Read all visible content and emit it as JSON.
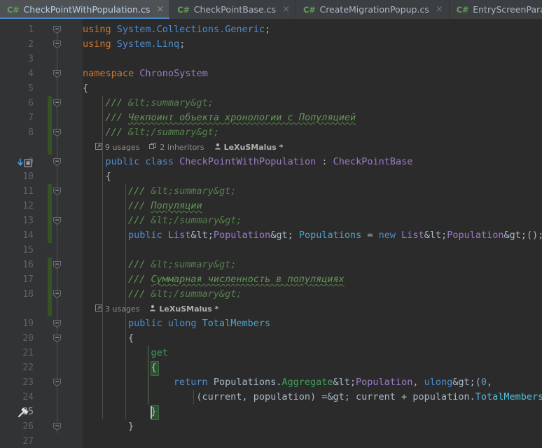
{
  "window": {
    "app": "IDE code editor",
    "theme_bg": "#2b2b2b",
    "gutter_bg": "#313335",
    "tabbar_bg": "#3c3f41",
    "accent": "#4a88c7",
    "changebar_color": "#375224"
  },
  "tabs": [
    {
      "icon": "csharp-file-icon",
      "icon_label": "C#",
      "label": "CheckPointWithPopulation.cs",
      "close": "×",
      "active": true
    },
    {
      "icon": "csharp-file-icon",
      "icon_label": "C#",
      "label": "CheckPointBase.cs",
      "close": "×",
      "active": false
    },
    {
      "icon": "csharp-file-icon",
      "icon_label": "C#",
      "label": "CreateMigrationPopup.cs",
      "close": "×",
      "active": false
    },
    {
      "icon": "csharp-file-icon",
      "icon_label": "C#",
      "label": "EntryScreenParamsBlockLoops.cs",
      "close": "×",
      "active": false
    }
  ],
  "editor": {
    "language": "csharp",
    "current_line": 25,
    "line_numbers": [
      1,
      2,
      3,
      4,
      5,
      6,
      7,
      8,
      9,
      10,
      11,
      12,
      13,
      14,
      15,
      16,
      17,
      18,
      19,
      20,
      21,
      22,
      23,
      24,
      25,
      26,
      27
    ],
    "lines": [
      {
        "n": 1,
        "text": "using System.Collections.Generic;"
      },
      {
        "n": 2,
        "text": "using System.Linq;"
      },
      {
        "n": 3,
        "text": ""
      },
      {
        "n": 4,
        "text": "namespace ChronoSystem"
      },
      {
        "n": 5,
        "text": "{"
      },
      {
        "n": 6,
        "text": "    /// <summary>"
      },
      {
        "n": 7,
        "text": "    /// Чекпоинт объекта хронологии с Популяцией"
      },
      {
        "n": 8,
        "text": "    /// </summary>"
      },
      {
        "n": 9,
        "text": "    public class CheckPointWithPopulation : CheckPointBase"
      },
      {
        "n": 10,
        "text": "    {"
      },
      {
        "n": 11,
        "text": "        /// <summary>"
      },
      {
        "n": 12,
        "text": "        /// Популяции"
      },
      {
        "n": 13,
        "text": "        /// </summary>"
      },
      {
        "n": 14,
        "text": "        public List<Population> Populations = new List<Population>();"
      },
      {
        "n": 15,
        "text": ""
      },
      {
        "n": 16,
        "text": "        /// <summary>"
      },
      {
        "n": 17,
        "text": "        /// Суммарная численность в популяциях"
      },
      {
        "n": 18,
        "text": "        /// </summary>"
      },
      {
        "n": 19,
        "text": "        public ulong TotalMembers"
      },
      {
        "n": 20,
        "text": "        {"
      },
      {
        "n": 21,
        "text": "            get"
      },
      {
        "n": 22,
        "text": "            {"
      },
      {
        "n": 23,
        "text": "                return Populations.Aggregate<Population, ulong>(0,"
      },
      {
        "n": 24,
        "text": "                    (current, population) => current + population.TotalMembers);"
      },
      {
        "n": 25,
        "text": "            }"
      },
      {
        "n": 26,
        "text": "        }"
      },
      {
        "n": 27,
        "text": ""
      }
    ],
    "code_tokens": {
      "l1": {
        "kw": "using",
        "ns": "System.Collections.Generic",
        "semi": ";"
      },
      "l2": {
        "kw": "using",
        "ns": "System.Linq",
        "semi": ";"
      },
      "l4": {
        "kw": "namespace",
        "name": "ChronoSystem"
      },
      "l5": {
        "brace": "{"
      },
      "l6": {
        "comment": "/// ",
        "tag": "<summary>"
      },
      "l7": {
        "comment": "/// ",
        "text": "Чекпоинт объекта хронологии с Популяцией"
      },
      "l8": {
        "comment": "/// ",
        "tag": "</summary>"
      },
      "l9": {
        "mod": "public",
        "kw": "class",
        "name": "CheckPointWithPopulation",
        "colon": " : ",
        "base": "CheckPointBase"
      },
      "l10": {
        "brace": "{"
      },
      "l11": {
        "comment": "/// ",
        "tag": "<summary>"
      },
      "l12": {
        "comment": "/// ",
        "text": "Популяции"
      },
      "l13": {
        "comment": "/// ",
        "tag": "</summary>"
      },
      "l14": {
        "mod": "public",
        "type": "List",
        "lt": "<",
        "generic": "Population",
        "gt": ">",
        "field": "Populations",
        "eq": " = ",
        "new": "new",
        "type2": "List",
        "generic2": "Population",
        "tail": "();"
      },
      "l16": {
        "comment": "/// ",
        "tag": "<summary>"
      },
      "l17": {
        "comment": "/// ",
        "text": "Суммарная численность в популяциях"
      },
      "l18": {
        "comment": "/// ",
        "tag": "</summary>"
      },
      "l19": {
        "mod": "public",
        "type": "ulong",
        "name": "TotalMembers"
      },
      "l20": {
        "brace": "{"
      },
      "l21": {
        "kw": "get"
      },
      "l22": {
        "brace": "{"
      },
      "l23": {
        "kw": "return",
        "obj": "Populations",
        "dot": ".",
        "method": "Aggregate",
        "lt": "<",
        "g1": "Population",
        "comma": ", ",
        "g2": "ulong",
        "gt": ">",
        "open": "(",
        "num": "0",
        "c2": ","
      },
      "l24": {
        "open": "(",
        "p1": "current",
        "comma": ", ",
        "p2": "population",
        "close": ")",
        "arrow": " => ",
        "v1": "current",
        "plus": " + ",
        "v2": "population",
        "dot": ".",
        "prop": "TotalMembers",
        "tail": ");"
      },
      "l25": {
        "brace": "}"
      },
      "l26": {
        "brace": "}"
      }
    },
    "codelens": [
      {
        "above_line": 9,
        "segments": [
          {
            "icon": "usages-icon",
            "label": "9 usages"
          },
          {
            "icon": "inheritors-icon",
            "label": "2 inheritors"
          },
          {
            "icon": "author-icon",
            "label": "LeXuSMalus *",
            "is_author": true
          }
        ]
      },
      {
        "above_line": 19,
        "segments": [
          {
            "icon": "usages-icon",
            "label": "3 usages"
          },
          {
            "icon": "author-icon",
            "label": "LeXuSMalus *",
            "is_author": true
          }
        ]
      }
    ],
    "gutter_icons": [
      {
        "line": 9,
        "icon": "implementing-member-icon",
        "tooltip": "Overriding / implementing member"
      },
      {
        "line": 25,
        "icon": "hammer-icon",
        "tooltip": "Build / quick fix"
      }
    ],
    "spellcheck_words": [
      "Чекпоинт",
      "объекта",
      "хронологии",
      "Популяцией",
      "Популяции",
      "Суммарная",
      "численность",
      "популяциях"
    ]
  }
}
